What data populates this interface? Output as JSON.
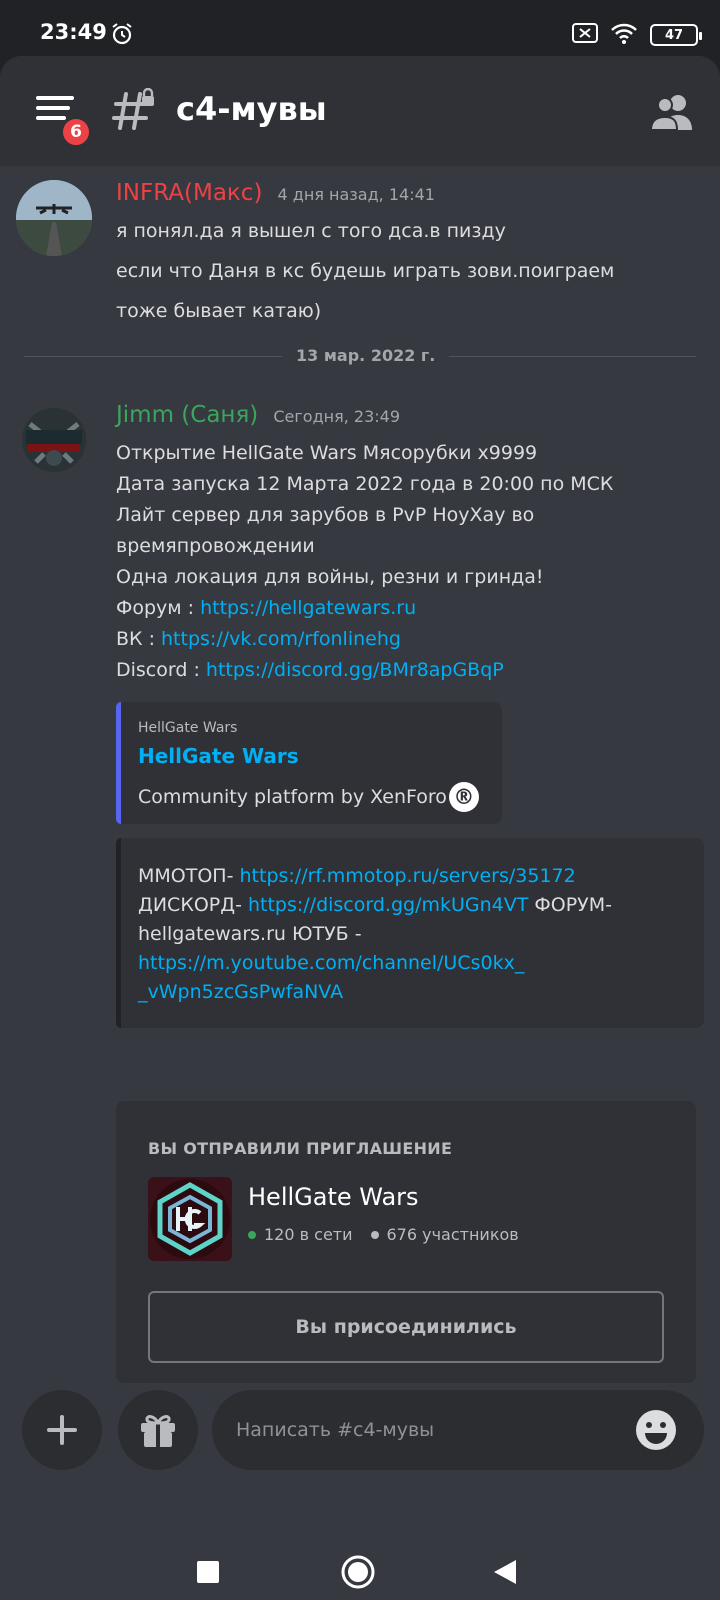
{
  "status_bar": {
    "time": "23:49",
    "battery": "47"
  },
  "header": {
    "title": "c4-мувы",
    "notification_count": "6"
  },
  "messages": [
    {
      "author": "INFRA(Макс)",
      "author_color": "#ed4245",
      "timestamp": "4 дня назад, 14:41",
      "lines": [
        "я понял.да я вышел с того дса.в пизду",
        "если что Даня в кс будешь играть зови.поиграем",
        "тоже бывает катаю)"
      ]
    },
    {
      "author": "Jimm (Саня)",
      "author_color": "#3ba55c",
      "timestamp": "Сегодня, 23:49",
      "lines": [
        "Открытие HellGate Wars Мясорубки x9999",
        "Дата запуска 12 Марта 2022 года в 20:00 по МСК",
        "Лайт сервер для зарубов в PvP НоуХау во",
        "времяпровождении",
        "Одна локация для войны, резни и гринда!"
      ],
      "links": [
        {
          "label": "Форум : ",
          "url": "https://hellgatewars.ru"
        },
        {
          "label": "ВК : ",
          "url": "https://vk.com/rfonlinehg"
        },
        {
          "label": "Discord : ",
          "url": "https://discord.gg/BMr8apGBqP"
        }
      ]
    }
  ],
  "date_divider": "13 мар. 2022 г.",
  "link_embed": {
    "provider": "HellGate Wars",
    "title": "HellGate Wars",
    "description": "Community platform by XenForo",
    "trademark": "®"
  },
  "text_embed": {
    "prefix_1": "ММОТОП- ",
    "link_1": "https://rf.mmotop.ru/servers/35172",
    "prefix_2": "ДИСКОРД- ",
    "link_2": "https://discord.gg/mkUGn4VT",
    "middle": " ФОРУМ-",
    "forum_text": "hellgatewars.ru ЮТУБ -",
    "link_3a": "https://m.youtube.com/channel/UCs0kx_",
    "link_3b": "_vWpn5zcGsPwfaNVA"
  },
  "invite": {
    "heading": "ВЫ ОТПРАВИЛИ ПРИГЛАШЕНИЕ",
    "server_name": "HellGate Wars",
    "online": "120 в сети",
    "members": "676 участников",
    "button_label": "Вы присоединились",
    "online_color": "#3ba55c",
    "members_color": "#b9bbbe"
  },
  "composer": {
    "placeholder": "Написать #c4-мувы"
  },
  "icons": [
    "alarm-icon",
    "sim-off-icon",
    "wifi-icon",
    "battery-icon",
    "menu-icon",
    "channel-locked-icon",
    "members-icon",
    "plus-icon",
    "gift-icon",
    "emoji-icon",
    "nav-recents-icon",
    "nav-home-icon",
    "nav-back-icon"
  ]
}
